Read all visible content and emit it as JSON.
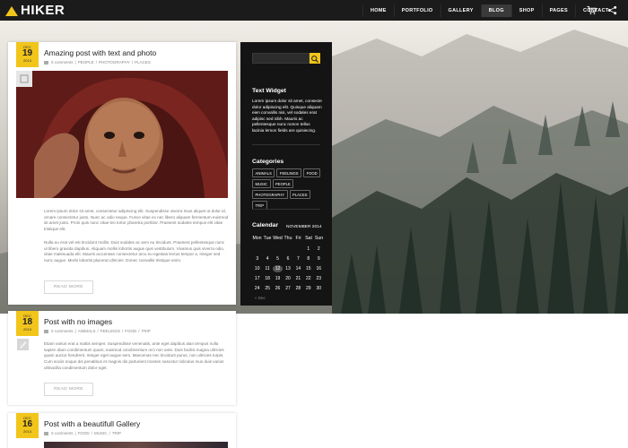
{
  "brand": {
    "name": "HIKER",
    "accent": "#f2c51b"
  },
  "nav": {
    "items": [
      "HOME",
      "PORTFOLIO",
      "GALLERY",
      "BLOG",
      "SHOP",
      "PAGES",
      "CONTACT"
    ],
    "active": "BLOG",
    "icons": [
      "cart-icon",
      "share-icon"
    ]
  },
  "posts": [
    {
      "month": "DEC",
      "day": "19",
      "year": "2013",
      "title": "Amazing post with text and photo",
      "meta": [
        "0 comments",
        "PEOPLE",
        "PHOTOGRAPHY",
        "PLACES"
      ],
      "format_icon": "image-icon",
      "excerpt_1": "Lorem ipsum dolor sit amet, consectetur adipiscing elit. Suspendisse viverra risus aliquet ut dolor id, ornare consectetur justo. Nunc ac odio neque. Fusce vitae ex nec libero aliquam fermentum euismod sit amet justo. Proin quis nunc vitae leo tortor pharetra porttitor. Praesent sodales tempus elit vitae tristique elit.",
      "excerpt_2": "Nulla eu erat vel est tincidunt mollis. Duis sodales ac sem eu tincidunt. Praesent pellentesque nunc ut libero gravida dapibus. Aliquam mollis lobortis augue quis vestibulum. Vivamus quis viverra odio, vitae malesuada elit. Mauris accumsan consectetur arcu eu egestas lectus tempor a. Integer sed nunc augue. Morbi lobortis placerat ultricies. Donec convallis tristique enim.",
      "read_more": "READ MORE"
    },
    {
      "month": "DEC",
      "day": "18",
      "year": "2013",
      "title": "Post with no images",
      "meta": [
        "0 comments",
        "ANIMALS",
        "FEELINGS",
        "FOOD",
        "TRIP"
      ],
      "format_icon": "pen-icon",
      "excerpt_1": "Etiam varius erat a mattis semper. Suspendisse venenatis, ante eget dapibus alan tempus nulla sapien diam condimentum quam, euismod condimentum orci non ante. Duis facilisi magna ultricies quam auctor hendrerit. Integer eget augue sem. Maecenas nec tincidunt purus, non ultricies turpis. Cum sociis noque dis penatibus et magnis dis parturient montes nascetur ridiculus mus duis varius ullmacilla condimentum dolor eget.",
      "read_more": "READ MORE"
    },
    {
      "month": "DEC",
      "day": "16",
      "year": "2013",
      "title": "Post with a beautifull Gallery",
      "meta": [
        "0 comments",
        "FOOD",
        "MUSIC",
        "TRIP"
      ]
    }
  ],
  "sidebar": {
    "text_widget_title": "Text Widget",
    "text_widget_body": "Lorem ipsum dolor sit amet, consecte dolor adipiscing elit. Quisque aliquam eien convallis nisi, vel sodales erat adipisc sed nibh. Mauris ac pellentesque nunc nonon tellus lacinia lemon fields are quisiecing.",
    "categories_title": "Categories",
    "categories": [
      "ANIMALS",
      "FEELINGS",
      "FOOD",
      "MUSIC",
      "PEOPLE",
      "PHOTOGRAPHY",
      "PLACES",
      "TRIP"
    ],
    "calendar_title": "Calendar",
    "calendar_caption": "NOVEMBER 2014",
    "weekdays": [
      "Mon",
      "Tue",
      "Wed",
      "Thu",
      "Fri",
      "Sat",
      "Sun"
    ],
    "weeks": [
      [
        "",
        "",
        "",
        "",
        "",
        "1",
        "2"
      ],
      [
        "3",
        "4",
        "5",
        "6",
        "7",
        "8",
        "9"
      ],
      [
        "10",
        "11",
        "12",
        "13",
        "14",
        "15",
        "16"
      ],
      [
        "17",
        "18",
        "19",
        "20",
        "21",
        "22",
        "23"
      ],
      [
        "24",
        "25",
        "26",
        "27",
        "28",
        "29",
        "30"
      ]
    ],
    "today": "12",
    "prev_link": "« Dec"
  }
}
